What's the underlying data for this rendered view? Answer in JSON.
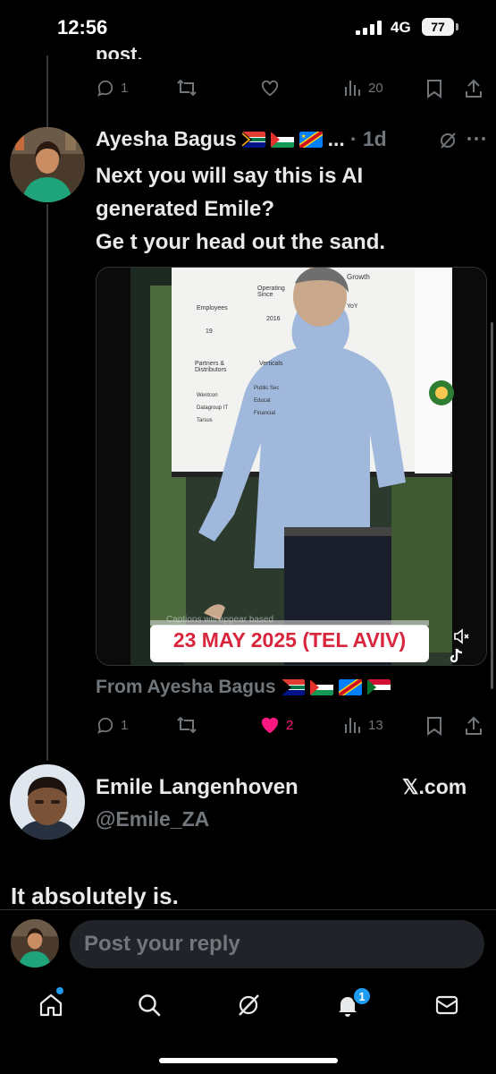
{
  "status_bar": {
    "time": "12:56",
    "network": "4G",
    "battery": "77"
  },
  "prev_tweet": {
    "truncated_text": "post.",
    "replies": "1",
    "views": "20"
  },
  "tweet": {
    "author_name": "Ayesha Bagus",
    "name_suffix": "...",
    "time": "· 1d",
    "lines": [
      "Next you will say this is AI",
      "generated Emile?",
      "Ge t your head out the sand."
    ],
    "media": {
      "slide_headers": [
        "Employees",
        "Operating Since",
        "Growth"
      ],
      "slide_values": [
        "19",
        "2016",
        "YoY"
      ],
      "slide_labels": [
        "Partners & Distributors",
        "Verticals"
      ],
      "slide_list_left": [
        "Wentcon",
        "Datagroup IT",
        "Tarsus"
      ],
      "slide_list_right": [
        "Public Sec",
        "Educat",
        "Financial"
      ],
      "captions_overlay": "Captions will appear based",
      "date_banner": "23 MAY 2025 (TEL AVIV)"
    },
    "from_label": "From Ayesha Bagus",
    "replies": "1",
    "likes": "2",
    "views": "13",
    "like_color": "#f91880"
  },
  "quoted": {
    "name": "Emile Langenhoven",
    "handle": "@Emile_ZA",
    "source": "𝕏.com",
    "text": "It absolutely is."
  },
  "reply": {
    "placeholder": "Post your reply"
  },
  "tabbar": {
    "icons": [
      "home-icon",
      "search-icon",
      "grok-icon",
      "bell-icon",
      "mail-icon"
    ],
    "notifications_badge": "1"
  },
  "colors": {
    "background": "#000000",
    "accent": "#1d9bf0",
    "muted": "#71767b"
  }
}
